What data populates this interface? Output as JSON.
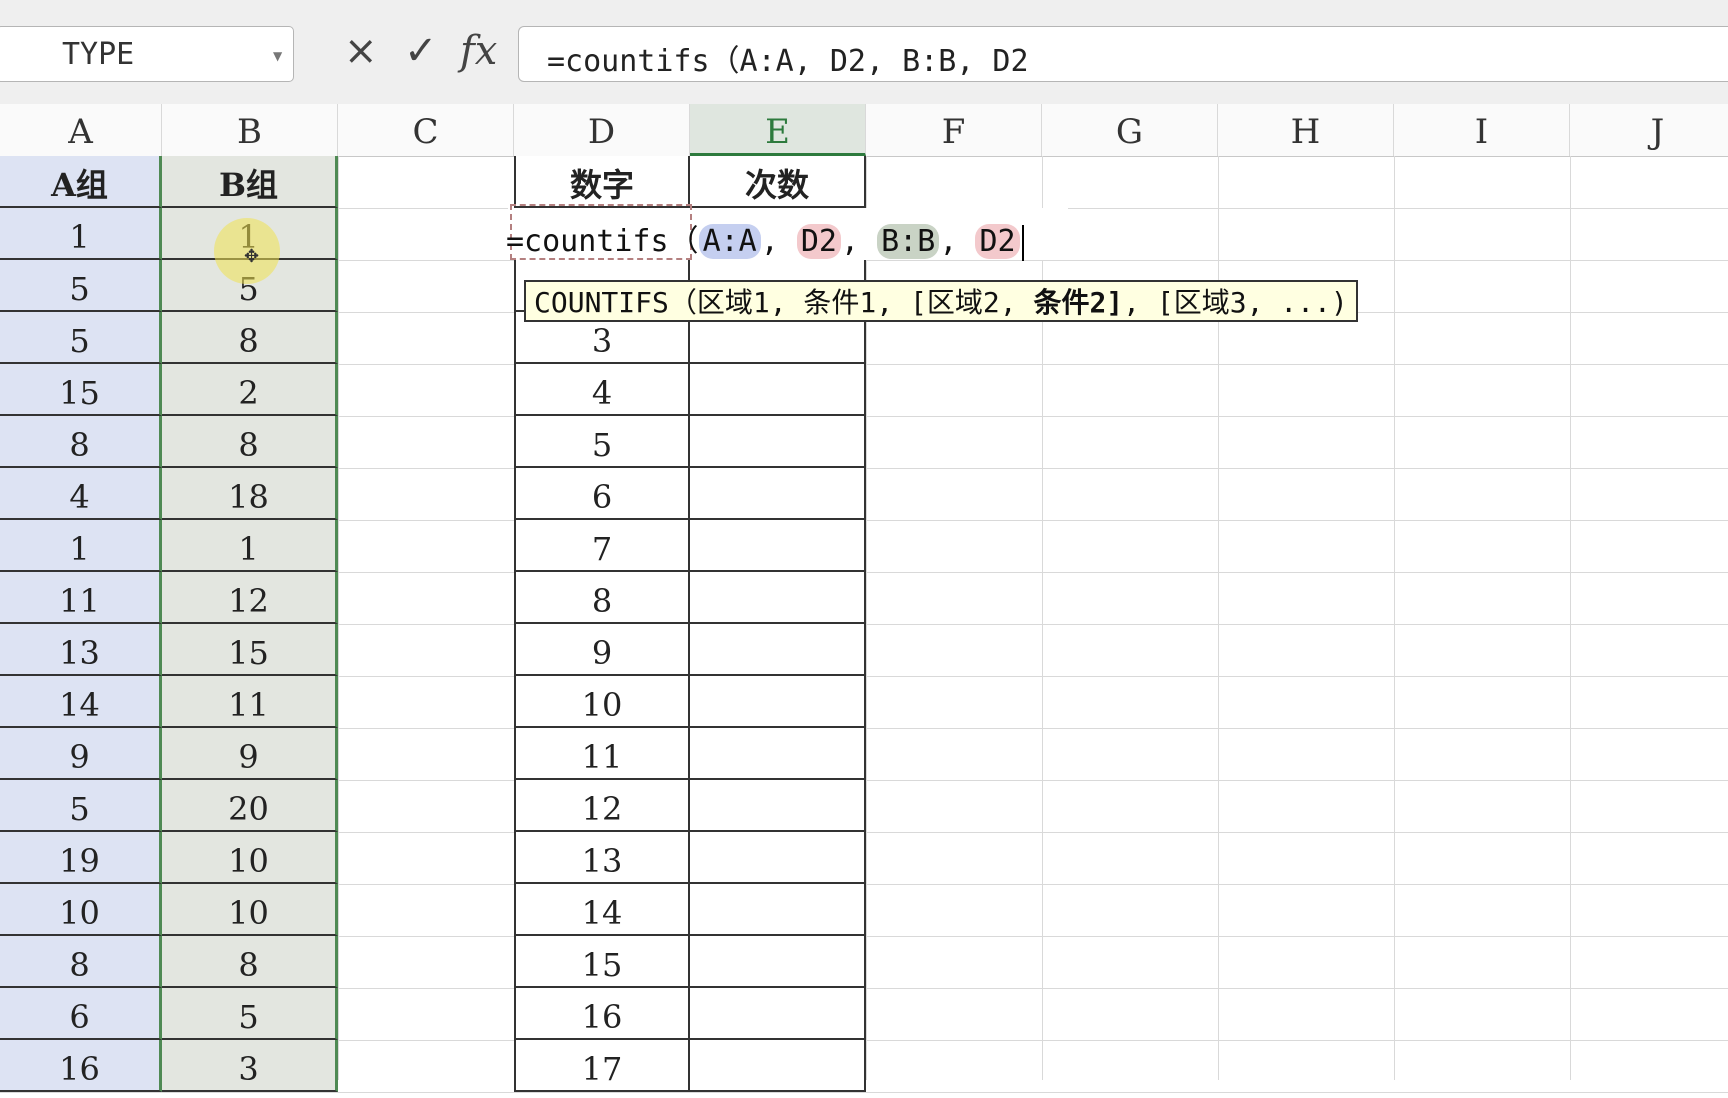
{
  "name_box": {
    "value": "TYPE"
  },
  "formula_bar": {
    "cancel_icon": "×",
    "confirm_icon": "✓",
    "fx_label": "fx",
    "formula": "=countifs（A:A, D2, B:B, D2"
  },
  "columns": [
    "A",
    "B",
    "C",
    "D",
    "E",
    "F",
    "G",
    "H",
    "I",
    "J"
  ],
  "active_column": "E",
  "sheet": {
    "headers": {
      "a": "A组",
      "b": "B组",
      "d": "数字",
      "e": "次数"
    },
    "col_a": [
      "1",
      "5",
      "5",
      "15",
      "8",
      "4",
      "1",
      "11",
      "13",
      "14",
      "9",
      "5",
      "19",
      "10",
      "8",
      "6",
      "16"
    ],
    "col_b": [
      "1",
      "5",
      "8",
      "2",
      "8",
      "18",
      "1",
      "12",
      "15",
      "11",
      "9",
      "20",
      "10",
      "10",
      "8",
      "5",
      "3"
    ],
    "col_d": [
      "",
      "",
      "3",
      "4",
      "5",
      "6",
      "7",
      "8",
      "9",
      "10",
      "11",
      "12",
      "13",
      "14",
      "15",
      "16",
      "17"
    ]
  },
  "edit": {
    "prefix": "=countifs（",
    "ref1": "A:A",
    "sep1": ", ",
    "ref2": "D2",
    "sep2": ", ",
    "ref3": "B:B",
    "sep3": ", ",
    "ref4": "D2"
  },
  "tooltip": {
    "before": "COUNTIFS（区域1, 条件1, [区域2, ",
    "bold": "条件2]",
    "after": ", [区域3, ...)"
  },
  "colors": {
    "accent": "#2d7a3d",
    "col_a_fill": "#dde3f3",
    "col_b_fill": "#e3e6e0",
    "tooltip_bg": "#ffffe1"
  }
}
